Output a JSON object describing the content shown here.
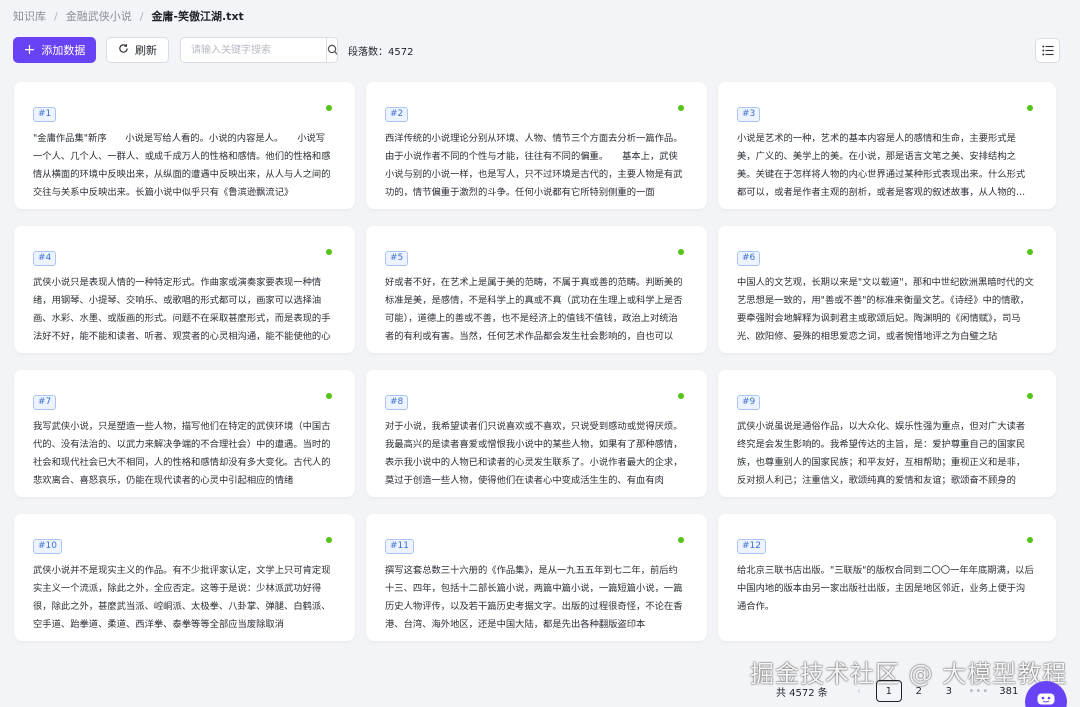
{
  "breadcrumb": {
    "items": [
      "知识库",
      "金融武侠小说",
      "金庸-笑傲江湖.txt"
    ],
    "separator": "/"
  },
  "toolbar": {
    "add_label": "添加数据",
    "refresh_label": "刷新",
    "search_placeholder": "请输入关键字搜索",
    "para_count_label": "段落数：4572"
  },
  "cards": [
    {
      "index": "#1",
      "text": "\"金庸作品集\"新序　　小说是写给人看的。小说的内容是人。　　小说写一个人、几个人、一群人、或成千成万人的性格和感情。他们的性格和感情从横面的环境中反映出来，从纵面的遭遇中反映出来，从人与人之间的交往与关系中反映出来。长篇小说中似乎只有《鲁滨逊飘流记》"
    },
    {
      "index": "#2",
      "text": "西洋传统的小说理论分别从环境、人物、情节三个方面去分析一篇作品。由于小说作者不同的个性与才能，往往有不同的偏重。　　基本上，武侠小说与别的小说一样，也是写人，只不过环境是古代的，主要人物是有武功的，情节偏重于激烈的斗争。任何小说都有它所特别侧重的一面"
    },
    {
      "index": "#3",
      "text": "小说是艺术的一种，艺术的基本内容是人的感情和生命，主要形式是美，广义的、美学上的美。在小说，那是语言文笔之美、安排结构之美。关键在于怎样将人物的内心世界通过某种形式表现出来。什么形式都可以，或者是作者主观的剖析，或者是客观的叙述故事，从人物的行动和言语中"
    },
    {
      "index": "#4",
      "text": "武侠小说只是表现人情的一种特定形式。作曲家或演奏家要表现一种情绪，用钢琴、小提琴、交响乐、或歌唱的形式都可以，画家可以选择油画、水彩、水墨、或版画的形式。问题不在采取甚麼形式，而是表现的手法好不好，能不能和读者、听者、观赏者的心灵相沟通，能不能使他的心"
    },
    {
      "index": "#5",
      "text": "好或者不好，在艺术上是属于美的范畴，不属于真或善的范畴。判断美的标准是美，是感情，不是科学上的真或不真（武功在生理上或科学上是否可能），道德上的善或不善，也不是经济上的值钱不值钱，政治上对统治者的有利或有害。当然，任何艺术作品都会发生社会影响的，自也可以"
    },
    {
      "index": "#6",
      "text": "中国人的文艺观，长期以来是\"文以载道\"，那和中世纪欧洲黑暗时代的文艺思想是一致的，用\"善或不善\"的标准来衡量文艺。《诗经》中的情歌，要牵强附会地解释为讽刺君主或歌颂后妃。陶渊明的《闲情赋》，司马光、欧阳修、晏殊的相思爱恋之词，或者惋惜地评之为白璧之玷"
    },
    {
      "index": "#7",
      "text": "我写武侠小说，只是塑造一些人物，描写他们在特定的武侠环境（中国古代的、没有法治的、以武力来解决争端的不合理社会）中的遭遇。当时的社会和现代社会已大不相同，人的性格和感情却没有多大变化。古代人的悲欢离合、喜怒哀乐，仍能在现代读者的心灵中引起相应的情绪"
    },
    {
      "index": "#8",
      "text": "对于小说，我希望读者们只说喜欢或不喜欢，只说受到感动或觉得厌烦。我最高兴的是读者喜爱或憎恨我小说中的某些人物，如果有了那种感情，表示我小说中的人物已和读者的心灵发生联系了。小说作者最大的企求，莫过于创造一些人物，使得他们在读者心中变成活生生的、有血有肉"
    },
    {
      "index": "#9",
      "text": "武侠小说虽说是通俗作品，以大众化、娱乐性强为重点，但对广大读者终究是会发生影响的。我希望传达的主旨，是：爱护尊重自己的国家民族，也尊重别人的国家民族；和平友好，互相帮助；重视正义和是非，反对损人利己；注重信义，歌颂纯真的爱情和友谊；歌颂奋不顾身的"
    },
    {
      "index": "#10",
      "text": "武侠小说并不是现实主义的作品。有不少批评家认定，文学上只可肯定现实主义一个流派，除此之外，全应否定。这等于是说：少林派武功好得很，除此之外，甚麼武当派、崆峒派、太极拳、八卦掌、弹腿、白鹤派、空手道、跆拳道、柔道、西洋拳、泰拳等等全部应当废除取消"
    },
    {
      "index": "#11",
      "text": "撰写这套总数三十六册的《作品集》，是从一九五五年到七二年，前后约十三、四年，包括十二部长篇小说，两篇中篇小说，一篇短篇小说，一篇历史人物评传，以及若干篇历史考据文字。出版的过程很奇怪，不论在香港、台湾、海外地区，还是中国大陆，都是先出各种翻版盗印本"
    },
    {
      "index": "#12",
      "text": "给北京三联书店出版。\"三联版\"的版权合同到二〇〇一年年底期满，以后中国内地的版本由另一家出版社出版，主因是地区邻近，业务上便于沟通合作。"
    }
  ],
  "pagination": {
    "total_label": "共 4572 条",
    "pages": [
      "1",
      "2",
      "3",
      "•••",
      "381"
    ]
  },
  "watermark": "掘金技术社区 @ 大模型教程",
  "colors": {
    "accent": "#6842f5",
    "status_dot": "#52c41a",
    "badge_text": "#3a6fd8",
    "background": "#f3f4f7"
  }
}
